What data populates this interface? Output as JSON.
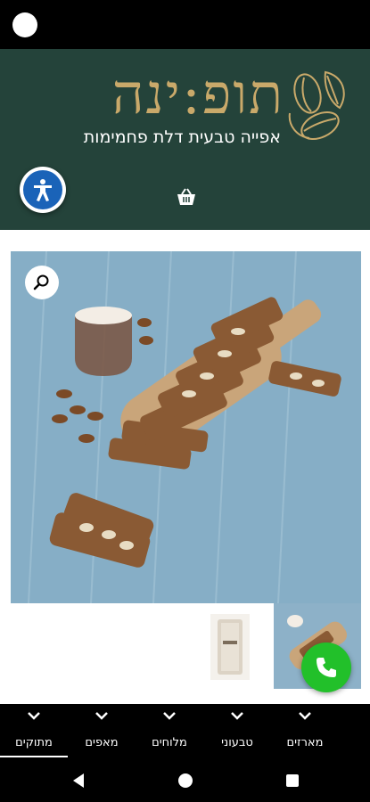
{
  "brand": {
    "title": "תופ:ינה",
    "tagline": "אפייה טבעית דלת פחמימות"
  },
  "icons": {
    "accessibility": "accessibility-icon",
    "cart": "shopping-basket-icon",
    "zoom": "magnifier-icon",
    "call": "phone-icon",
    "logo": "almond-leaves-logo"
  },
  "categories": [
    {
      "label": "מתוקים",
      "active": true
    },
    {
      "label": "מאפים",
      "active": false
    },
    {
      "label": "מלוחים",
      "active": false
    },
    {
      "label": "טבעוני",
      "active": false
    },
    {
      "label": "מארזים",
      "active": false
    }
  ],
  "colors": {
    "header_bg": "#24433a",
    "brand_gold": "#c9a96a",
    "call_green": "#22c02a",
    "a11y_blue": "#1a63b8"
  }
}
